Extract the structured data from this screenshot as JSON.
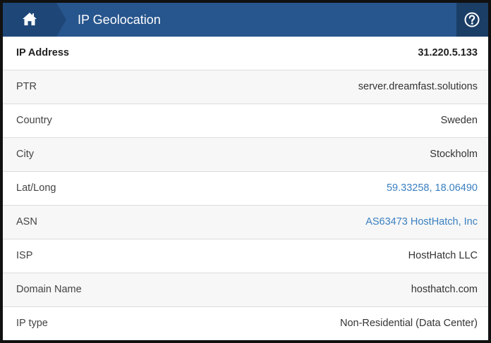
{
  "header": {
    "title": "IP Geolocation",
    "home_icon": "home-icon",
    "help_icon": "question-circle-icon",
    "colors": {
      "bar": "#27558d",
      "home_block": "#1e4778",
      "help_block": "#1b3e66",
      "link": "#3a7fc0"
    }
  },
  "rows": [
    {
      "label": "IP Address",
      "value": "31.220.5.133"
    },
    {
      "label": "PTR",
      "value": "server.dreamfast.solutions"
    },
    {
      "label": "Country",
      "value": "Sweden"
    },
    {
      "label": "City",
      "value": "Stockholm"
    },
    {
      "label": "Lat/Long",
      "value": "59.33258, 18.06490"
    },
    {
      "label": "ASN",
      "value": "AS63473 HostHatch, Inc"
    },
    {
      "label": "ISP",
      "value": "HostHatch LLC"
    },
    {
      "label": "Domain Name",
      "value": "hosthatch.com"
    },
    {
      "label": "IP type",
      "value": "Non-Residential (Data Center)"
    }
  ]
}
